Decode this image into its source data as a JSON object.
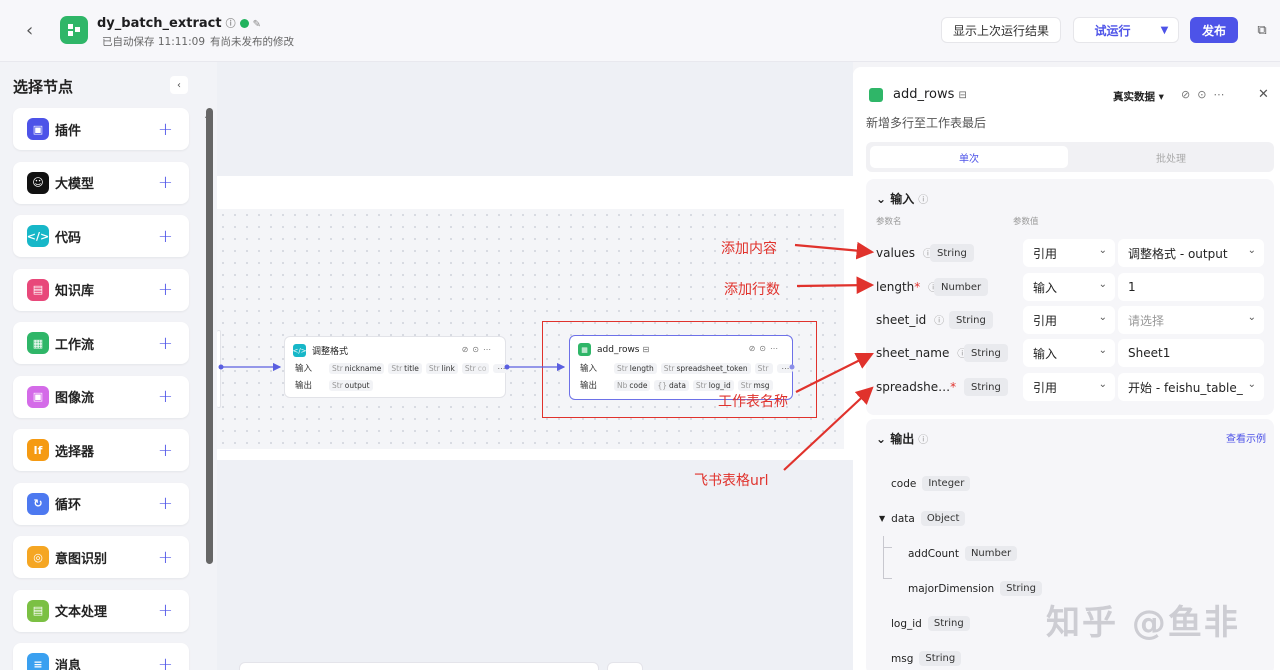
{
  "header": {
    "app_title": "dy_batch_extract",
    "autosave": "已自动保存 11:11:09",
    "unpublished": "有尚未发布的修改",
    "show_last_run": "显示上次运行结果",
    "test_run": "试运行",
    "publish": "发布"
  },
  "left_panel": {
    "title": "选择节点",
    "items": [
      {
        "label": "插件",
        "color": "#4d53e8"
      },
      {
        "label": "大模型",
        "color": "#111111"
      },
      {
        "label": "代码",
        "color": "#17b7c8"
      },
      {
        "label": "知识库",
        "color": "#e8487a"
      },
      {
        "label": "工作流",
        "color": "#2fb668"
      },
      {
        "label": "图像流",
        "color": "#d46be8"
      },
      {
        "label": "选择器",
        "color": "#f59a12"
      },
      {
        "label": "循环",
        "color": "#4d79f0"
      },
      {
        "label": "意图识别",
        "color": "#f5a623"
      },
      {
        "label": "文本处理",
        "color": "#7bc043"
      },
      {
        "label": "消息",
        "color": "#3aa0f0"
      }
    ]
  },
  "canvas": {
    "node1": {
      "title": "调整格式",
      "input_label": "输入",
      "output_label": "输出",
      "inputs": [
        {
          "type": "Str",
          "name": "nickname"
        },
        {
          "type": "Str",
          "name": "title"
        },
        {
          "type": "Str",
          "name": "link"
        },
        {
          "type": "Str",
          "name": "co"
        }
      ],
      "outputs": [
        {
          "type": "Str",
          "name": "output"
        }
      ]
    },
    "node2": {
      "title": "add_rows",
      "input_label": "输入",
      "output_label": "输出",
      "inputs": [
        {
          "type": "Str",
          "name": "length"
        },
        {
          "type": "Str",
          "name": "spreadsheet_token"
        },
        {
          "type": "Str",
          "name": ""
        }
      ],
      "outputs": [
        {
          "type": "Nb",
          "name": "code"
        },
        {
          "type": "{}",
          "name": "data"
        },
        {
          "type": "Str",
          "name": "log_id"
        },
        {
          "type": "Str",
          "name": "msg"
        }
      ]
    }
  },
  "annotations": {
    "values": "添加内容",
    "length": "添加行数",
    "sheet_name": "工作表名称",
    "spreadsheet": "飞书表格url"
  },
  "right_panel": {
    "title": "add_rows",
    "real_data": "真实数据",
    "description": "新增多行至工作表最后",
    "tab_single": "单次",
    "tab_batch": "批处理",
    "input_title": "输入",
    "col_param_name": "参数名",
    "col_param_value": "参数值",
    "params": [
      {
        "name": "values",
        "required": false,
        "type": "String",
        "mode": "引用",
        "value": "调整格式 - output",
        "has_chevron": true,
        "placeholder": false
      },
      {
        "name": "length",
        "required": true,
        "type": "Number",
        "mode": "输入",
        "value": "1",
        "has_chevron": false,
        "placeholder": false
      },
      {
        "name": "sheet_id",
        "required": false,
        "type": "String",
        "mode": "引用",
        "value": "请选择",
        "has_chevron": true,
        "placeholder": true
      },
      {
        "name": "sheet_name",
        "required": false,
        "type": "String",
        "mode": "输入",
        "value": "Sheet1",
        "has_chevron": false,
        "placeholder": false
      },
      {
        "name": "spreadshe…",
        "required": true,
        "type": "String",
        "mode": "引用",
        "value": "开始 - feishu_table_",
        "has_chevron": true,
        "placeholder": false
      }
    ],
    "output_title": "输出",
    "view_example": "查看示例",
    "outputs": [
      {
        "name": "code",
        "type": "Integer"
      },
      {
        "name": "data",
        "type": "Object"
      },
      {
        "name": "addCount",
        "type": "Number"
      },
      {
        "name": "majorDimension",
        "type": "String"
      },
      {
        "name": "log_id",
        "type": "String"
      },
      {
        "name": "msg",
        "type": "String"
      }
    ]
  },
  "watermark": "知乎 @鱼非"
}
